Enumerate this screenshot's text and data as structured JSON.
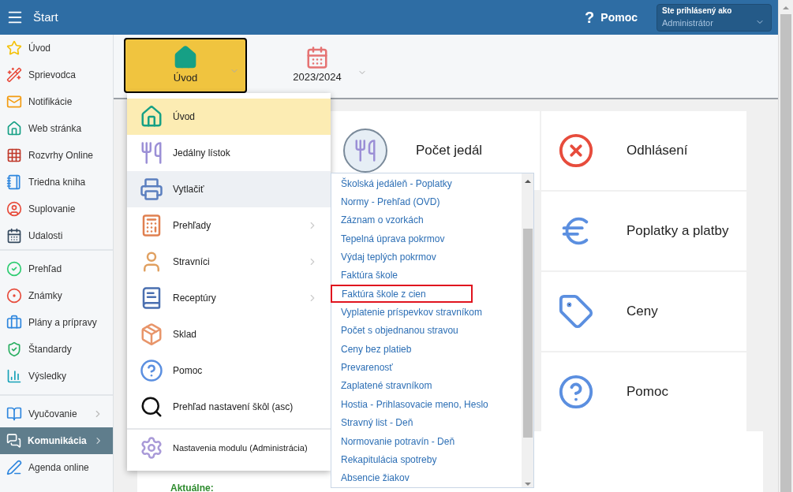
{
  "header": {
    "title": "Štart",
    "help": "Pomoc",
    "help_mark": "?",
    "user": {
      "label": "Ste prihlásený ako",
      "name": "Administrátor"
    }
  },
  "sidebar": {
    "groups": [
      [
        {
          "label": "Úvod",
          "selected": false,
          "expandable": false
        },
        {
          "label": "Sprievodca",
          "selected": false,
          "expandable": false
        },
        {
          "label": "Notifikácie",
          "selected": false,
          "expandable": false
        },
        {
          "label": "Web stránka",
          "selected": false,
          "expandable": false
        },
        {
          "label": "Rozvrhy Online",
          "selected": false,
          "expandable": false
        },
        {
          "label": "Triedna kniha",
          "selected": false,
          "expandable": false
        },
        {
          "label": "Suplovanie",
          "selected": false,
          "expandable": false
        },
        {
          "label": "Udalosti",
          "selected": false,
          "expandable": false
        }
      ],
      [
        {
          "label": "Prehľad",
          "selected": false,
          "expandable": false
        },
        {
          "label": "Známky",
          "selected": false,
          "expandable": false
        },
        {
          "label": "Plány a prípravy",
          "selected": false,
          "expandable": false
        },
        {
          "label": "Štandardy",
          "selected": false,
          "expandable": false
        },
        {
          "label": "Výsledky",
          "selected": false,
          "expandable": false
        }
      ],
      [
        {
          "label": "Vyučovanie",
          "selected": false,
          "expandable": true
        },
        {
          "label": "Komunikácia",
          "selected": true,
          "expandable": true
        },
        {
          "label": "Agenda online",
          "selected": false,
          "expandable": false
        }
      ]
    ]
  },
  "toolbar": {
    "module": {
      "label": "Úvod",
      "selected": true
    },
    "year": {
      "label": "2023/2024"
    }
  },
  "menu": {
    "items": [
      {
        "label": "Úvod",
        "selected": true,
        "open": false,
        "expandable": false
      },
      {
        "label": "Jedálny lístok",
        "selected": false,
        "open": false,
        "expandable": false
      },
      {
        "label": "Vytlačiť",
        "selected": false,
        "open": true,
        "expandable": false
      },
      {
        "label": "Prehľady",
        "selected": false,
        "open": false,
        "expandable": true
      },
      {
        "label": "Stravníci",
        "selected": false,
        "open": false,
        "expandable": true
      },
      {
        "label": "Receptúry",
        "selected": false,
        "open": false,
        "expandable": true
      },
      {
        "label": "Sklad",
        "selected": false,
        "open": false,
        "expandable": false
      },
      {
        "label": "Pomoc",
        "selected": false,
        "open": false,
        "expandable": false
      },
      {
        "label": "Prehľad nastavení škôl (asc)",
        "selected": false,
        "open": false,
        "expandable": false
      }
    ],
    "footer_item": {
      "label": "Nastavenia modulu (Administrácia)"
    }
  },
  "submenu": {
    "items": [
      {
        "label": "Školská jedáleň - Poplatky",
        "highlighted": false
      },
      {
        "label": "Normy - Prehľad (OVD)",
        "highlighted": false
      },
      {
        "label": "Záznam o vzorkách",
        "highlighted": false
      },
      {
        "label": "Tepelná úprava pokrmov",
        "highlighted": false
      },
      {
        "label": "Výdaj teplých pokrmov",
        "highlighted": false
      },
      {
        "label": "Faktúra škole",
        "highlighted": false
      },
      {
        "label": "Faktúra škole z cien",
        "highlighted": true
      },
      {
        "label": "Vyplatenie príspevkov stravníkom",
        "highlighted": false
      },
      {
        "label": "Počet s objednanou stravou",
        "highlighted": false
      },
      {
        "label": "Ceny bez platieb",
        "highlighted": false
      },
      {
        "label": "Prevarenosť",
        "highlighted": false
      },
      {
        "label": "Zaplatené stravníkom",
        "highlighted": false
      },
      {
        "label": "Hostia - Prihlasovacie meno, Heslo",
        "highlighted": false
      },
      {
        "label": "Stravný list - Deň",
        "highlighted": false
      },
      {
        "label": "Normovanie potravín - Deň",
        "highlighted": false
      },
      {
        "label": "Rekapitulácia spotreby",
        "highlighted": false
      },
      {
        "label": "Absencie žiakov",
        "highlighted": false
      }
    ]
  },
  "tiles": {
    "middle": [
      {
        "label": "Počet jedál"
      }
    ],
    "right": [
      {
        "label": "Odhlásení"
      },
      {
        "label": "Poplatky a platby"
      },
      {
        "label": "Ceny"
      },
      {
        "label": "Pomoc"
      }
    ]
  },
  "news": {
    "title": "Aktuálne:"
  }
}
